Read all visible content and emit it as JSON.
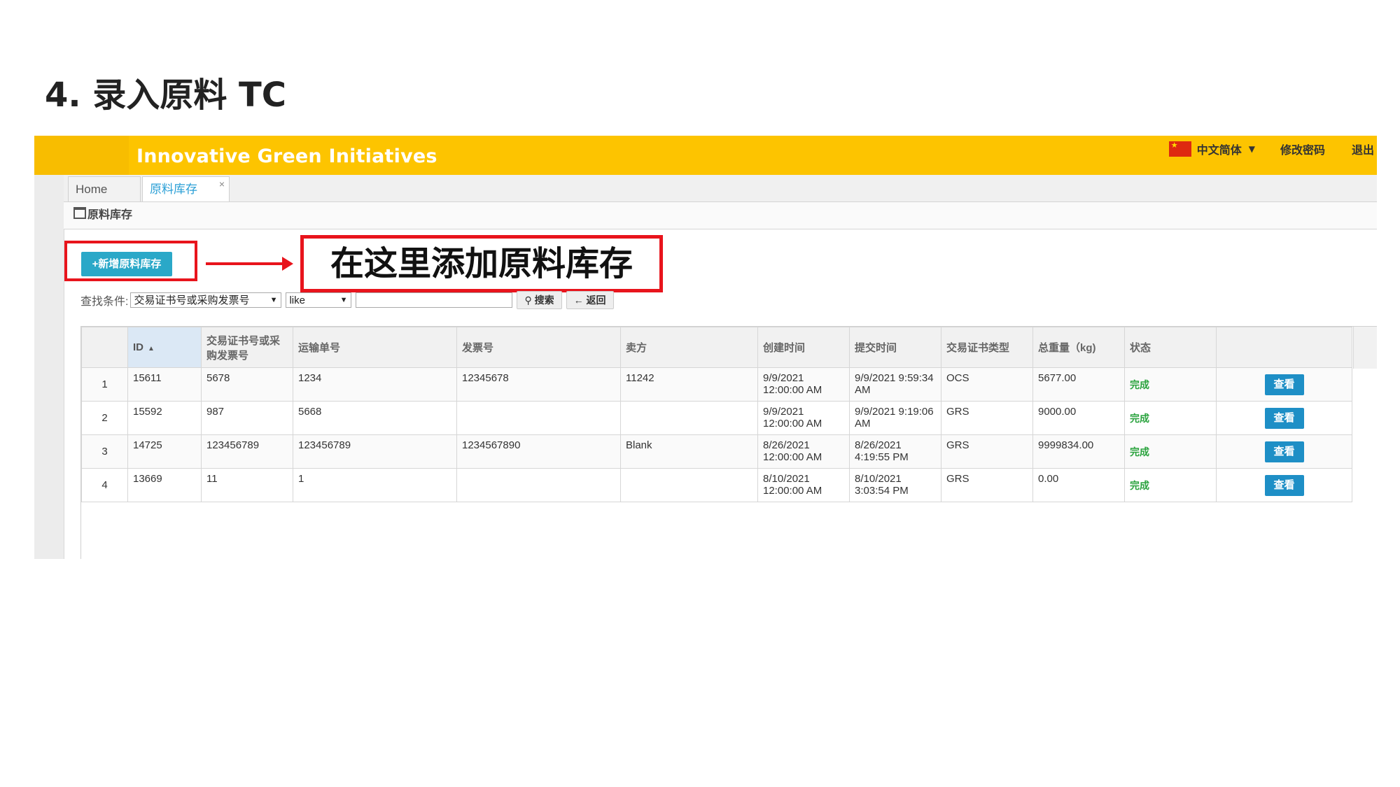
{
  "slide": {
    "title": "4. 录入原料 TC"
  },
  "app": {
    "brand": "Innovative Green Initiatives",
    "top_menu": {
      "language": "中文简体",
      "change_password": "修改密码",
      "logout": "退出"
    },
    "tabs": [
      {
        "label": "Home"
      },
      {
        "label": "原料库存",
        "close": "×"
      }
    ],
    "panel_title": "原料库存",
    "add_button": "+新增原料库存",
    "callout": "在这里添加原料库存",
    "search": {
      "label": "查找条件:",
      "field": "交易证书号或采购发票号",
      "operator": "like",
      "keyword": "",
      "search_button": "搜索",
      "back_button": "返回"
    },
    "table": {
      "columns": [
        "ID",
        "交易证书号或采购发票号",
        "运输单号",
        "发票号",
        "卖方",
        "创建时间",
        "提交时间",
        "交易证书类型",
        "总重量（kg)",
        "状态"
      ],
      "rows": [
        {
          "num": "1",
          "id": "15611",
          "tc": "5678",
          "ship": "1234",
          "invoice": "12345678",
          "seller": "11242",
          "created": "9/9/2021 12:00:00 AM",
          "submitted": "9/9/2021 9:59:34 AM",
          "type": "OCS",
          "weight": "5677.00",
          "status": "完成",
          "action": "查看"
        },
        {
          "num": "2",
          "id": "15592",
          "tc": "987",
          "ship": "5668",
          "invoice": "",
          "seller": "",
          "created": "9/9/2021 12:00:00 AM",
          "submitted": "9/9/2021 9:19:06 AM",
          "type": "GRS",
          "weight": "9000.00",
          "status": "完成",
          "action": "查看"
        },
        {
          "num": "3",
          "id": "14725",
          "tc": "123456789",
          "ship": "123456789",
          "invoice": "1234567890",
          "seller": "Blank",
          "created": "8/26/2021 12:00:00 AM",
          "submitted": "8/26/2021 4:19:55 PM",
          "type": "GRS",
          "weight": "9999834.00",
          "status": "完成",
          "action": "查看"
        },
        {
          "num": "4",
          "id": "13669",
          "tc": "11",
          "ship": "1",
          "invoice": "",
          "seller": "",
          "created": "8/10/2021 12:00:00 AM",
          "submitted": "8/10/2021 3:03:54 PM",
          "type": "GRS",
          "weight": "0.00",
          "status": "完成",
          "action": "查看"
        }
      ]
    },
    "colors": {
      "topbar": "#fdc400",
      "annotation": "#e8141c",
      "primary_button": "#2aa8c8",
      "view_button": "#1e8fc6",
      "status_done": "#2aa33e"
    }
  }
}
